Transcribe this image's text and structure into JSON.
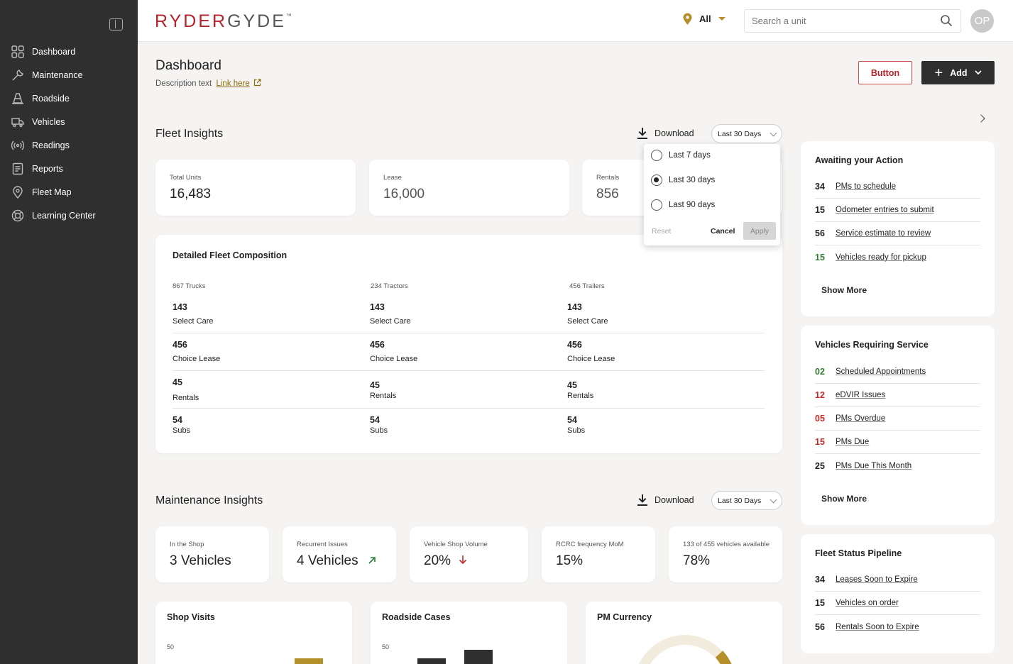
{
  "brand": {
    "logo_part1": "RYDER",
    "logo_part2": "GYDE",
    "logo_tm": "™"
  },
  "sidebar": {
    "items": [
      {
        "label": "Dashboard",
        "icon": "dashboard-icon"
      },
      {
        "label": "Maintenance",
        "icon": "wrench-icon"
      },
      {
        "label": "Roadside",
        "icon": "cone-icon"
      },
      {
        "label": "Vehicles",
        "icon": "truck-icon"
      },
      {
        "label": "Readings",
        "icon": "signal-icon"
      },
      {
        "label": "Reports",
        "icon": "report-icon"
      },
      {
        "label": "Fleet Map",
        "icon": "map-pin-icon"
      },
      {
        "label": "Learning Center",
        "icon": "lifebuoy-icon"
      }
    ]
  },
  "topbar": {
    "location": "All",
    "search_placeholder": "Search a unit",
    "avatar": "OP"
  },
  "header": {
    "title": "Dashboard",
    "description": "Description text",
    "link": "Link here",
    "button": "Button",
    "add": "Add"
  },
  "fleet": {
    "title": "Fleet Insights",
    "download": "Download",
    "range": "Last 30 Days",
    "kpis": [
      {
        "label": "Total Units",
        "value": "16,483"
      },
      {
        "label": "Lease",
        "value": "16,000"
      },
      {
        "label": "Rentals",
        "value": "856"
      }
    ],
    "dropdown": {
      "options": [
        "Last 7 days",
        "Last 30 days",
        "Last 90 days"
      ],
      "selected": 1,
      "reset": "Reset",
      "cancel": "Cancel",
      "apply": "Apply"
    },
    "composition": {
      "title": "Detailed Fleet Composition",
      "columns": [
        "867 Trucks",
        "234 Tractors",
        "456 Trailers"
      ],
      "rows": [
        {
          "value": "143",
          "label": "Select Care"
        },
        {
          "value": "456",
          "label": "Choice Lease"
        },
        {
          "value": "45",
          "label": "Rentals"
        },
        {
          "value": "54",
          "label": "Subs"
        }
      ]
    }
  },
  "maintenance": {
    "title": "Maintenance Insights",
    "download": "Download",
    "range": "Last 30 Days",
    "kpis": [
      {
        "label": "In the Shop",
        "value": "3 Vehicles"
      },
      {
        "label": "Recurrent Issues",
        "value": "4 Vehicles"
      },
      {
        "label": "Vehicle Shop Volume",
        "value": "20%"
      },
      {
        "label": "RCRC frequency MoM",
        "value": "15%"
      },
      {
        "label": "133 of 455 vehicles available",
        "value": "78%"
      }
    ]
  },
  "charts": {
    "shop_visits": "Shop Visits",
    "roadside": "Roadside Cases",
    "pm": "PM Currency",
    "axis_top": "50"
  },
  "chart_data": [
    {
      "type": "bar",
      "title": "Shop Visits",
      "ylim": [
        0,
        50
      ]
    },
    {
      "type": "bar",
      "title": "Roadside Cases",
      "ylim": [
        0,
        50
      ]
    },
    {
      "type": "pie",
      "title": "PM Currency"
    }
  ],
  "awaiting": {
    "title": "Awaiting your Action",
    "items": [
      {
        "num": "34",
        "label": "PMs to schedule",
        "color": "#222"
      },
      {
        "num": "15",
        "label": "Odometer entries to submit",
        "color": "#222"
      },
      {
        "num": "56",
        "label": "Service estimate to review",
        "color": "#222"
      },
      {
        "num": "15",
        "label": "Vehicles ready for pickup",
        "color": "#2e7d32"
      }
    ],
    "more": "Show More"
  },
  "service": {
    "title": "Vehicles Requiring Service",
    "items": [
      {
        "num": "02",
        "label": "Scheduled Appointments",
        "color": "#2e7d32"
      },
      {
        "num": "12",
        "label": "eDVIR Issues",
        "color": "#c62828"
      },
      {
        "num": "05",
        "label": "PMs Overdue",
        "color": "#c62828"
      },
      {
        "num": "15",
        "label": "PMs Due",
        "color": "#c62828"
      },
      {
        "num": "25",
        "label": "PMs Due This Month",
        "color": "#222"
      }
    ],
    "more": "Show More"
  },
  "pipeline": {
    "title": "Fleet Status Pipeline",
    "items": [
      {
        "num": "34",
        "label": "Leases Soon to Expire"
      },
      {
        "num": "15",
        "label": "Vehicles on order"
      },
      {
        "num": "56",
        "label": "Rentals Soon to Expire"
      }
    ]
  },
  "colors": {
    "brand_red": "#b5242c",
    "gold": "#b5902a",
    "sidebar": "#2f2f2f",
    "up": "#2e7d32",
    "down": "#c62828"
  }
}
